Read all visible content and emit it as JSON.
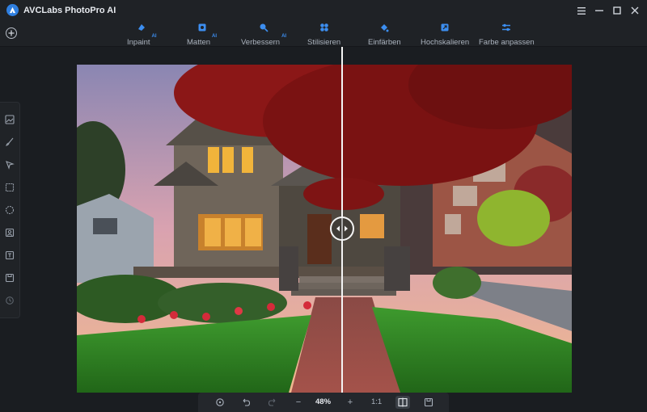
{
  "app": {
    "title": "AVCLabs PhotoPro AI"
  },
  "toolbar": {
    "tools": [
      {
        "label": "Inpaint",
        "ai_badge": "AI",
        "icon": "inpaint-icon"
      },
      {
        "label": "Matten",
        "ai_badge": "AI",
        "icon": "matte-icon"
      },
      {
        "label": "Verbessern",
        "ai_badge": "AI",
        "icon": "enhance-icon"
      },
      {
        "label": "Stilisieren",
        "ai_badge": "",
        "icon": "stylize-icon"
      },
      {
        "label": "Einfärben",
        "ai_badge": "",
        "icon": "colorize-icon"
      },
      {
        "label": "Hochskalieren",
        "ai_badge": "",
        "icon": "upscale-icon"
      },
      {
        "label": "Farbe anpassen",
        "ai_badge": "",
        "icon": "adjust-color-icon"
      }
    ]
  },
  "rail": {
    "tools": [
      "image-icon",
      "brush-icon",
      "select-arrow-icon",
      "rectangle-select-icon",
      "lasso-icon",
      "portrait-icon",
      "text-recognition-icon",
      "save-layer-icon",
      "history-icon"
    ]
  },
  "bottom": {
    "zoom": "48%",
    "ratio": "1:1",
    "zoom_out": "−",
    "zoom_in": "+"
  },
  "colors": {
    "accent": "#2f7fe0",
    "ai_badge": "#3c8ef0",
    "bg": "#1a1d21",
    "bar": "#1f2226"
  }
}
